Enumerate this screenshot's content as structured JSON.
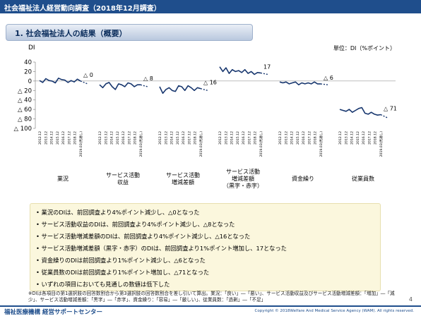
{
  "header": {
    "title": "社会福祉法人経営動向調査（2018年12月調査）"
  },
  "section": {
    "title": "1.  社会福祉法人の結果（概要）"
  },
  "chart_data": {
    "type": "line",
    "ylabel": "DI",
    "unit": "単位：DI（%ポイント）",
    "y_ticks": [
      "40",
      "20",
      "0",
      "△ 20",
      "△ 40",
      "△ 60",
      "△ 80",
      "△ 100"
    ],
    "ylim": [
      -100,
      40
    ],
    "x_tick_labels": [
      "2012.12",
      "2013.12",
      "2014.12",
      "2015.12",
      "2016.12",
      "2017.12",
      "2018.12",
      "2019.03(見通し)"
    ],
    "panels": [
      {
        "name": "業況",
        "values": [
          1,
          -3,
          5,
          1,
          0,
          -4,
          6,
          3,
          2,
          -3,
          1,
          -2,
          4,
          0
        ],
        "end_label": "△ 0",
        "forecast": -6
      },
      {
        "name": "サービス活動\n収益",
        "values": [
          -8,
          -14,
          -6,
          -3,
          -12,
          -18,
          -6,
          -8,
          -12,
          -4,
          -6,
          -12,
          -8,
          -8
        ],
        "end_label": "△ 8",
        "forecast": -12
      },
      {
        "name": "サービス活動\n増減差額",
        "values": [
          -12,
          -26,
          -18,
          -14,
          -20,
          -22,
          -10,
          -12,
          -20,
          -10,
          -14,
          -20,
          -14,
          -16
        ],
        "end_label": "△ 16",
        "forecast": -20
      },
      {
        "name": "サービス活動\n増減差額\n（黒字・赤字）",
        "values": [
          30,
          20,
          28,
          16,
          24,
          20,
          22,
          18,
          24,
          16,
          20,
          14,
          18,
          17
        ],
        "end_label": "17",
        "forecast": 14
      },
      {
        "name": "資金繰り",
        "values": [
          -2,
          -4,
          -2,
          -6,
          -4,
          -2,
          -8,
          -4,
          -6,
          -4,
          -6,
          -2,
          -6,
          -6
        ],
        "end_label": "△ 6",
        "forecast": -8
      },
      {
        "name": "従業員数",
        "values": [
          -60,
          -62,
          -64,
          -60,
          -66,
          -62,
          -58,
          -56,
          -68,
          -70,
          -66,
          -70,
          -72,
          -71
        ],
        "end_label": "△ 71",
        "forecast": -78
      }
    ]
  },
  "notes": [
    "• 業況のDIは、前回調査より4%ポイント減少し、△0となった",
    "• サービス活動収益のDIは、前回調査より4%ポイント減少し、△8となった",
    "• サービス活動増減差額のDIは、前回調査より4%ポイント減少し、△16となった",
    "• サービス活動増減差額（黒字・赤字）のDIは、前回調査より1%ポイント増加し、17となった",
    "• 資金繰りのDIは前回調査より1%ポイント減少し、△6となった",
    "• 従業員数のDIは前回調査より1%ポイント増加し、△71となった",
    "• いずれの項目においても見通しの数値は低下した"
  ],
  "footnote": "※DIは各項目の第1選択肢の回答数割合から第3選択肢の回答数割合を差し引いて算出。業況：「良い」―「悪い」、サービス活動収益及びサービス活動増減差額：「増加」―「減少」、サービス活動増減差額：「黒字」―「赤字」、資金繰り：「容易」―「厳しい」、従業員数：「過剰」―「不足」",
  "page": {
    "number": "4"
  },
  "footer": {
    "org": "福祉医療機構 経営サポートセンター",
    "copyright": "Copyright © 2018Welfare And Medical Service Agency (WAM). All rights reserved."
  },
  "colors": {
    "brand": "#1f4e8c",
    "series": "#17366e",
    "notes_bg": "#fbf7dd"
  }
}
